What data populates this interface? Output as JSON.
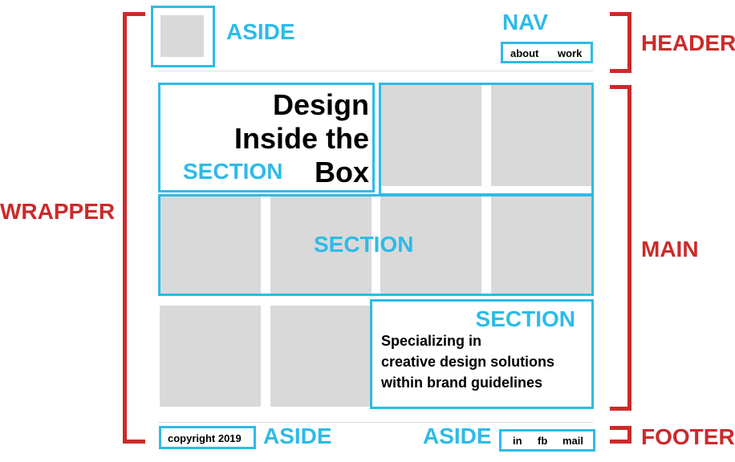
{
  "colors": {
    "annotation_blue": "#2dbbe8",
    "annotation_red": "#cc2a2a",
    "placeholder_gray": "#d9d9d9"
  },
  "labels": {
    "aside_top": "ASIDE",
    "nav": "NAV",
    "header": "HEADER",
    "main": "MAIN",
    "wrapper": "WRAPPER",
    "footer": "FOOTER",
    "section_title": "SECTION",
    "section_middle": "SECTION",
    "section_bottom": "SECTION",
    "aside_footer_left": "ASIDE",
    "aside_footer_right": "ASIDE"
  },
  "nav": {
    "items": [
      "about",
      "work"
    ]
  },
  "hero": {
    "line1": "Design",
    "line2": "Inside the",
    "line3": "Box"
  },
  "tagline": {
    "line1": "Specializing in",
    "line2": "creative design solutions",
    "line3": "within brand guidelines"
  },
  "footer": {
    "copyright": "copyright 2019",
    "social": [
      "in",
      "fb",
      "mail"
    ]
  },
  "icons": {
    "logo": "logo-placeholder"
  }
}
